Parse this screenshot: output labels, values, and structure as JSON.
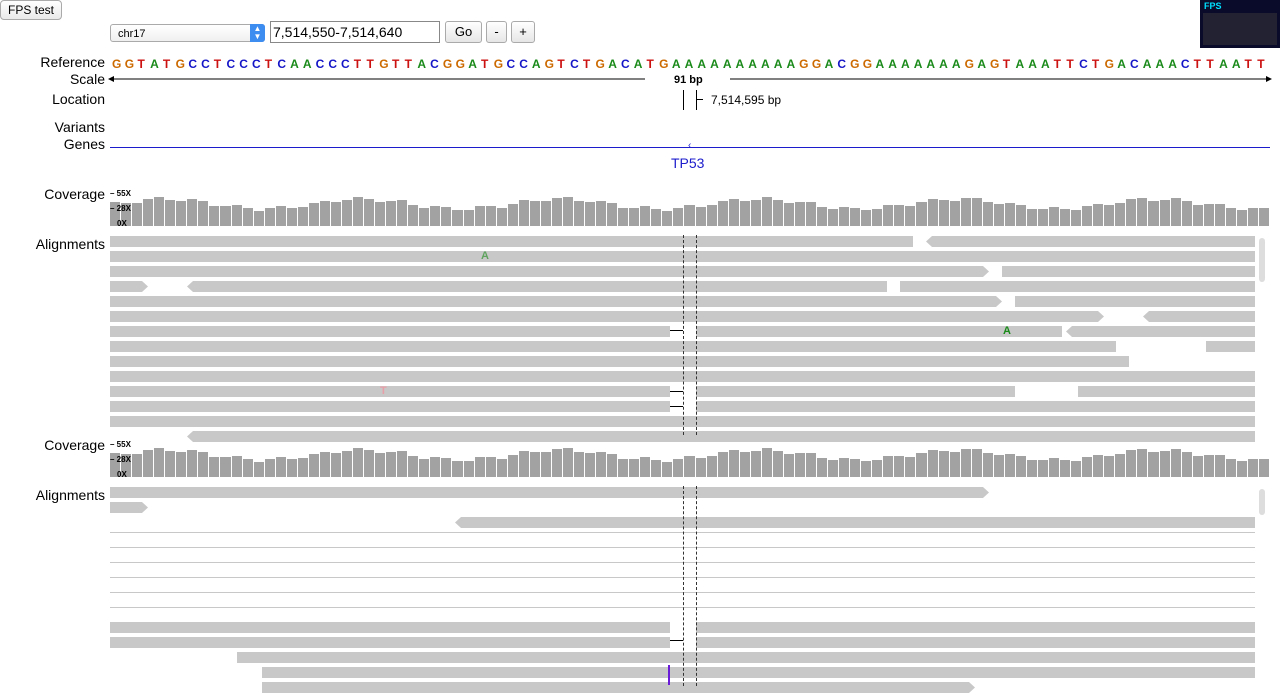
{
  "toolbar": {
    "fps_test_label": "FPS test",
    "chromosome": "chr17",
    "locus": "7,514,550-7,514,640",
    "go_label": "Go",
    "zoom_out_label": "-",
    "zoom_in_label": "+"
  },
  "fps_panel": {
    "label": "FPS"
  },
  "tracks": {
    "reference_label": "Reference",
    "scale_label": "Scale",
    "location_label": "Location",
    "variants_label": "Variants",
    "genes_label": "Genes",
    "coverage_label": "Coverage",
    "alignments_label": "Alignments"
  },
  "reference": {
    "sequence": "GGTATGCCTCCCTCAACCCTTGTTACGGATGCCAGTCTGACATGAAAAAAAAAAGGACGGAAAAAAAGAGTAAATTCTGACAAACTTAATT"
  },
  "scale": {
    "span": "91 bp"
  },
  "location": {
    "position": "7,514,595 bp"
  },
  "genes": {
    "name": "TP53"
  },
  "coverage": {
    "max": "55X",
    "mid": "28X",
    "min": "0X"
  },
  "mismatches": [
    {
      "base": "A",
      "color": "#5fa35f"
    },
    {
      "base": "A",
      "color": "#1a8a1a"
    },
    {
      "base": "T",
      "color": "#e8a0a8"
    }
  ],
  "colors": {
    "A": "#1a8a1a",
    "C": "#1515c8",
    "G": "#cc6a00",
    "T": "#cc1111",
    "gene": "#1c1ccc"
  }
}
